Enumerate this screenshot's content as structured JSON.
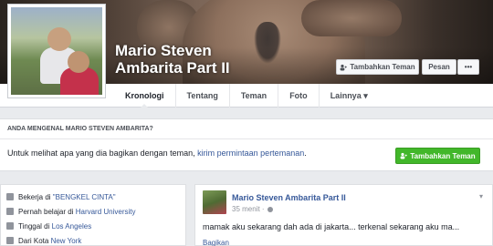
{
  "profile": {
    "name_line1": "Mario Steven",
    "name_line2": "Ambarita Part II"
  },
  "header_buttons": {
    "add_friend": "Tambahkan Teman",
    "message": "Pesan",
    "more": "•••"
  },
  "nav": {
    "tabs": [
      {
        "label": "Kronologi"
      },
      {
        "label": "Tentang"
      },
      {
        "label": "Teman"
      },
      {
        "label": "Foto"
      },
      {
        "label": "Lainnya ▾"
      }
    ]
  },
  "prompt": {
    "heading": "ANDA MENGENAL MARIO STEVEN AMBARITA?",
    "text_before": "Untuk melihat apa yang dia bagikan dengan teman, ",
    "link": "kirim permintaan pertemanan",
    "text_after": ".",
    "button": "Tambahkan Teman"
  },
  "intro": {
    "items": [
      {
        "prefix": "Bekerja di ",
        "link": "\"BENGKEL CINTA\""
      },
      {
        "prefix": "Pernah belajar di ",
        "link": "Harvard University"
      },
      {
        "prefix": "Tinggal di ",
        "link": "Los Angeles"
      },
      {
        "prefix": "Dari Kota ",
        "link": "New York"
      }
    ]
  },
  "post": {
    "author": "Mario Steven Ambarita Part II",
    "time": "35 menit ·",
    "text": "mamak aku sekarang dah ada di jakarta... terkenal sekarang aku ma...",
    "share": "Bagikan"
  },
  "colors": {
    "link": "#365899",
    "green_button": "#42b72a",
    "page_bg": "#e9ebee"
  }
}
